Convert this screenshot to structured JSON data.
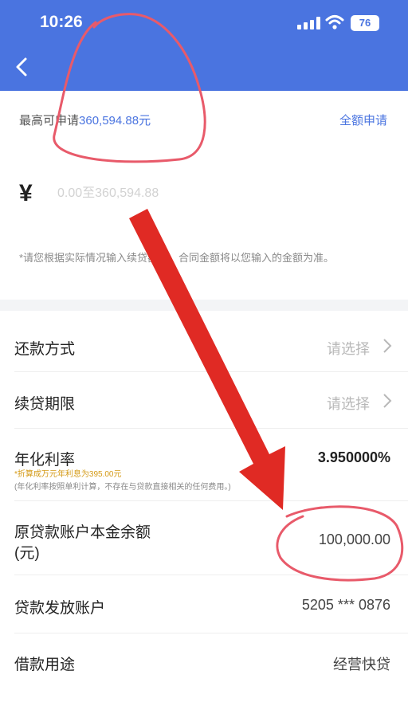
{
  "status_bar": {
    "time": "10:26",
    "battery": "76"
  },
  "apply": {
    "max_label": "最高可申请",
    "max_amount": "360,594.88元",
    "full_apply": "全额申请",
    "currency": "¥",
    "amount_placeholder": "0.00至360,594.88",
    "note": "*请您根据实际情况输入续贷额度，合同金额将以您输入的金额为准。"
  },
  "rows": {
    "repayment": {
      "label": "还款方式",
      "value": "请选择"
    },
    "term": {
      "label": "续贷期限",
      "value": "请选择"
    },
    "rate": {
      "label": "年化利率",
      "value": "3.950000%",
      "sub1": "*折算成万元年利息为395.00元",
      "sub2": "(年化利率按照单利计算，不存在与贷款直接相关的任何费用。)"
    },
    "principal": {
      "label": "原贷款账户本金余额",
      "label2": "(元)",
      "value": "100,000.00"
    },
    "account": {
      "label": "贷款发放账户",
      "value": "5205 *** 0876"
    },
    "purpose": {
      "label": "借款用途",
      "value": "经营快贷"
    }
  },
  "colors": {
    "brand": "#4a74e0",
    "annotation": "#e85a6a",
    "arrow": "#e02a24"
  }
}
